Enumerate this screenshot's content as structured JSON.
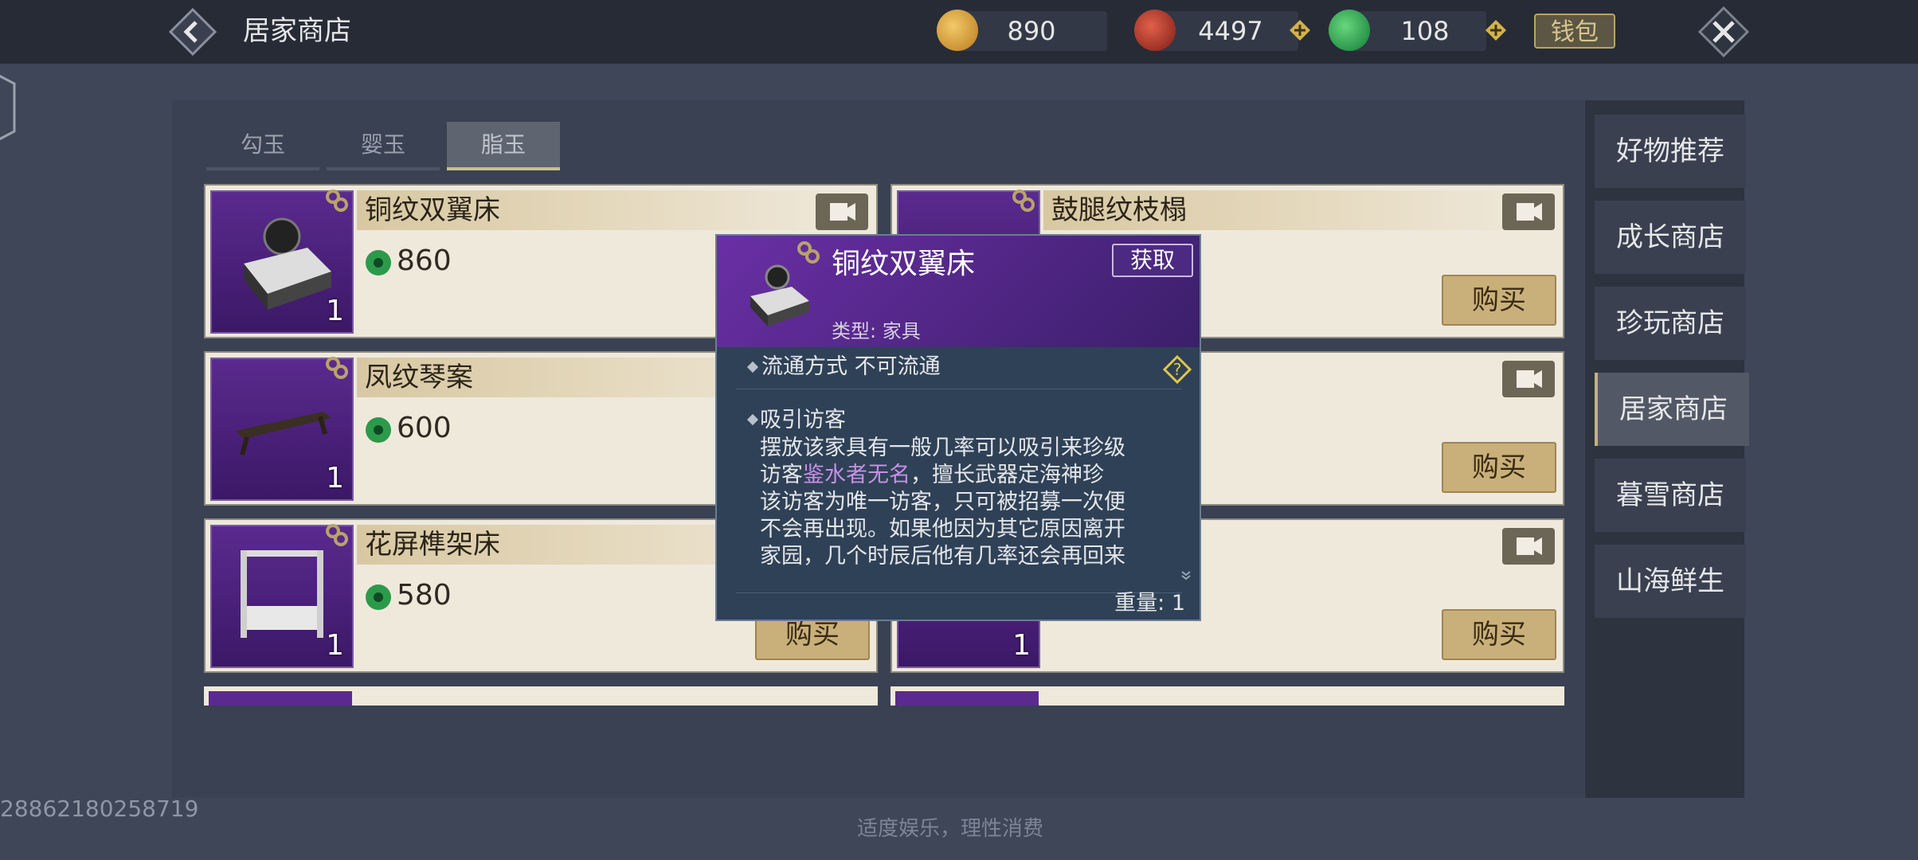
{
  "header": {
    "title": "居家商店",
    "currencies": [
      {
        "icon": "gold-jade-icon",
        "value": "890"
      },
      {
        "icon": "red-jade-icon",
        "value": "4497"
      },
      {
        "icon": "green-jade-icon",
        "value": "108"
      }
    ],
    "wallet_label": "钱包"
  },
  "tabs": [
    {
      "label": "勾玉",
      "active": false
    },
    {
      "label": "婴玉",
      "active": false
    },
    {
      "label": "脂玉",
      "active": true
    }
  ],
  "items": [
    {
      "name": "铜纹双翼床",
      "price": "860",
      "qty": "1",
      "buy_label": "购买"
    },
    {
      "name": "鼓腿纹枝榻",
      "price": "",
      "qty": "",
      "buy_label": "购买"
    },
    {
      "name": "凤纹琴案",
      "price": "600",
      "qty": "1",
      "buy_label": "购买"
    },
    {
      "name": "",
      "price": "",
      "qty": "",
      "buy_label": "购买"
    },
    {
      "name": "花屏榫架床",
      "price": "580",
      "qty": "1",
      "buy_label": "购买"
    },
    {
      "name": "",
      "price": "",
      "qty": "1",
      "buy_label": "购买"
    }
  ],
  "sidebar": {
    "items": [
      {
        "label": "好物推荐"
      },
      {
        "label": "成长商店"
      },
      {
        "label": "珍玩商店"
      },
      {
        "label": "居家商店"
      },
      {
        "label": "暮雪商店"
      },
      {
        "label": "山海鲜生"
      }
    ]
  },
  "popup": {
    "title": "铜纹双翼床",
    "get_label": "获取",
    "type_text": "类型: 家具",
    "flow_text": "流通方式   不可流通",
    "visit_title": "吸引访客",
    "desc_line1": "摆放该家具有一般几率可以吸引来珍级",
    "desc_line2_pre": "访客",
    "desc_line2_hl": "鉴水者无名",
    "desc_line2_post": "，擅长武器定海神珍",
    "desc_line3": "该访客为唯一访客，只可被招募一次便",
    "desc_line4": "不会再出现。如果他因为其它原因离开",
    "desc_line5": "家园，几个时辰后他有几率还会再回来",
    "weight_text": "重量: 1"
  },
  "footer": {
    "player_id": "28862180258719",
    "notice": "适度娱乐，理性消费"
  },
  "colors": {
    "accent_gold": "#c9b07a",
    "popup_header": "#6a2fa5",
    "highlight": "#c88fe8"
  }
}
